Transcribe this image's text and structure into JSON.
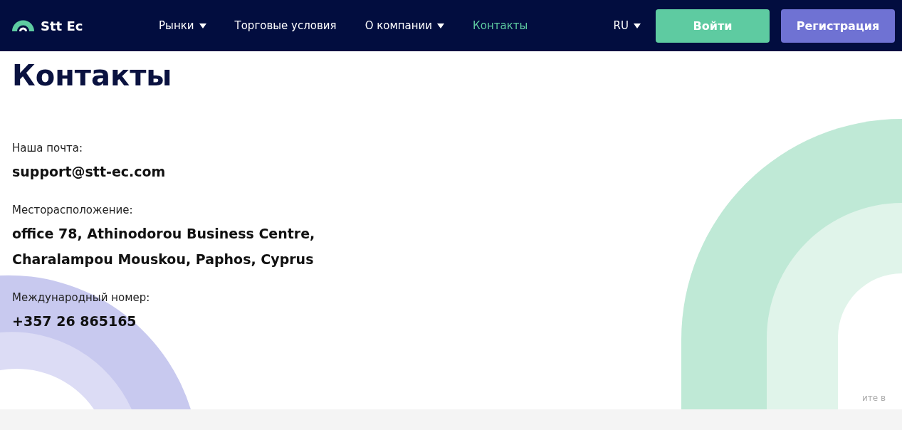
{
  "header": {
    "logo_text": "Stt Ec",
    "nav": [
      {
        "label": "Рынки",
        "dropdown": true,
        "selected": false
      },
      {
        "label": "Торговые условия",
        "dropdown": false,
        "selected": false
      },
      {
        "label": "О компании",
        "dropdown": true,
        "selected": false
      },
      {
        "label": "Контакты",
        "dropdown": false,
        "selected": true
      }
    ],
    "language": {
      "label": "RU",
      "dropdown": true
    },
    "buttons": [
      {
        "label": "Войти",
        "kind": "login"
      },
      {
        "label": "Регистрация",
        "kind": "register"
      }
    ]
  },
  "page_title": "Контакты",
  "contacts": [
    {
      "label": "Наша почта:",
      "lines": [
        "support@stt-ec.com"
      ]
    },
    {
      "label": "Месторасположение:",
      "lines": [
        "office 78, Athinodorou Business Centre,",
        "Charalampou Mouskou, Paphos, Cyprus"
      ]
    },
    {
      "label": "Международный номер:",
      "lines": [
        "+357 26 865165"
      ]
    }
  ],
  "fragment_text": "ите в"
}
